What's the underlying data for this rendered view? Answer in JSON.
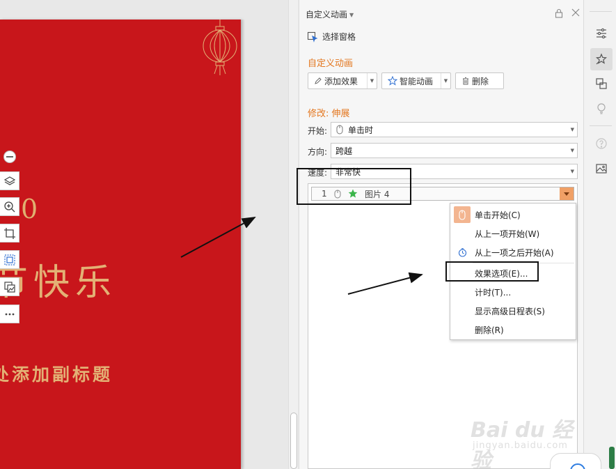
{
  "slide": {
    "digit": "0",
    "title": "节快乐",
    "subtitle": "处添加副标题"
  },
  "pane": {
    "title": "自定义动画",
    "select_pane_label": "选择窗格",
    "section_title": "自定义动画",
    "buttons": {
      "add_effect": "添加效果",
      "smart_animation": "智能动画",
      "delete": "删除"
    },
    "modify_title": "修改: 伸展",
    "start": {
      "label": "开始:",
      "value": "单击时"
    },
    "direction": {
      "label": "方向:",
      "value": "跨越"
    },
    "speed": {
      "label": "速度:",
      "value": "非常快"
    },
    "animation_item": {
      "number": "1",
      "name": "图片 4"
    }
  },
  "context_menu": {
    "items": [
      {
        "label": "单击开始(C)",
        "icon": "mouse-click-icon"
      },
      {
        "label": "从上一项开始(W)",
        "icon": ""
      },
      {
        "label": "从上一项之后开始(A)",
        "icon": "clock-icon"
      },
      {
        "label": "效果选项(E)...",
        "icon": ""
      },
      {
        "label": "计时(T)...",
        "icon": ""
      },
      {
        "label": "显示高级日程表(S)",
        "icon": ""
      },
      {
        "label": "删除(R)",
        "icon": ""
      }
    ]
  },
  "watermark": {
    "logo": "Bai du 经验",
    "url": "jingyan.baidu.com"
  },
  "colors": {
    "slide_red": "#c8161b",
    "gold_text": "#e3b175",
    "accent_orange": "#e3761e",
    "dropdown_orange": "#f0a066"
  }
}
